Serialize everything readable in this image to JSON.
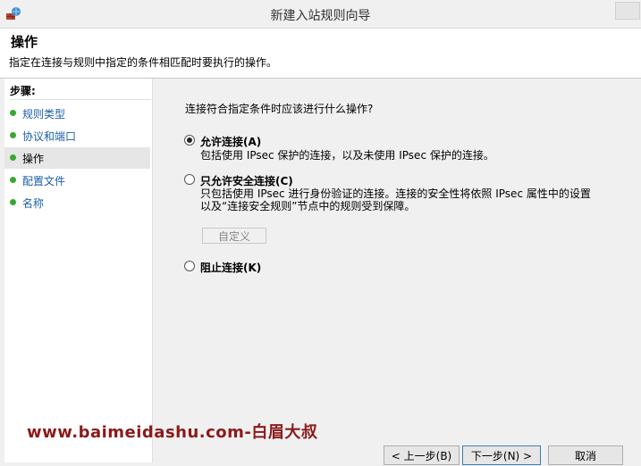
{
  "window": {
    "title": "新建入站规则向导"
  },
  "header": {
    "title": "操作",
    "description": "指定在连接与规则中指定的条件相匹配时要执行的操作。"
  },
  "steps": {
    "title": "步骤:",
    "items": [
      {
        "label": "规则类型",
        "active": false
      },
      {
        "label": "协议和端口",
        "active": false
      },
      {
        "label": "操作",
        "active": true
      },
      {
        "label": "配置文件",
        "active": false
      },
      {
        "label": "名称",
        "active": false
      }
    ]
  },
  "main": {
    "question": "连接符合指定条件时应该进行什么操作?",
    "options": [
      {
        "label": "允许连接(A)",
        "description": "包括使用 IPsec 保护的连接，以及未使用 IPsec 保护的连接。",
        "selected": true
      },
      {
        "label": "只允许安全连接(C)",
        "description": "只包括使用 IPsec 进行身份验证的连接。连接的安全性将依照 IPsec 属性中的设置以及“连接安全规则”节点中的规则受到保障。",
        "selected": false
      },
      {
        "label": "阻止连接(K)",
        "description": "",
        "selected": false
      }
    ],
    "customize_label": "自定义"
  },
  "watermark": "www.baimeidashu.com-白眉大叔",
  "buttons": {
    "back": "< 上一步(B)",
    "next": "下一步(N) >",
    "cancel": "取消"
  }
}
